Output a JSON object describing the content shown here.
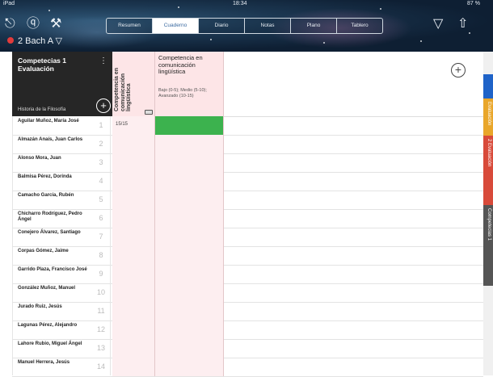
{
  "status_bar": {
    "device": "iPad",
    "time": "18:34",
    "battery": "87 %"
  },
  "nav": {
    "class_label": "2 Bach A"
  },
  "tabs": [
    {
      "label": "Resumen",
      "active": false
    },
    {
      "label": "Cuaderno",
      "active": true
    },
    {
      "label": "Diario",
      "active": false
    },
    {
      "label": "Notas",
      "active": false
    },
    {
      "label": "Plano",
      "active": false
    },
    {
      "label": "Tablero",
      "active": false
    }
  ],
  "header": {
    "title": "Competecias 1 Evaluación",
    "subject": "Historia de la Filosofía",
    "col1_title": "Competencia en comunicación lingüística",
    "col2_title": "Competencia en comunicación lingüística",
    "col2_desc": "Bajo (0-5); Medio (5-10); Avanzado (10-15)"
  },
  "students": [
    {
      "name": "Aguilar Muñoz, María José",
      "num": "1",
      "score": "15/15",
      "green": true
    },
    {
      "name": "Almazán Anaís, Juan Carlos",
      "num": "2",
      "score": "",
      "green": false
    },
    {
      "name": "Alonso Mora, Juan",
      "num": "3",
      "score": "",
      "green": false
    },
    {
      "name": "Balmisa Pérez, Dorinda",
      "num": "4",
      "score": "",
      "green": false
    },
    {
      "name": "Camacho García, Rubén",
      "num": "5",
      "score": "",
      "green": false
    },
    {
      "name": "Chicharro Rodríguez, Pedro Ángel",
      "num": "6",
      "score": "",
      "green": false
    },
    {
      "name": "Conejero Álvarez, Santiago",
      "num": "7",
      "score": "",
      "green": false
    },
    {
      "name": "Corpas Gómez, Jaime",
      "num": "8",
      "score": "",
      "green": false
    },
    {
      "name": "Garrido Plaza, Francisco José",
      "num": "9",
      "score": "",
      "green": false
    },
    {
      "name": "González Muñoz, Manuel",
      "num": "10",
      "score": "",
      "green": false
    },
    {
      "name": "Jurado Ruiz, Jesús",
      "num": "11",
      "score": "",
      "green": false
    },
    {
      "name": "Lagunas Pérez, Alejandro",
      "num": "12",
      "score": "",
      "green": false
    },
    {
      "name": "Lahore Rubio, Miguel Ángel",
      "num": "13",
      "score": "",
      "green": false
    },
    {
      "name": "Manuel Herrera, Jesús",
      "num": "14",
      "score": "",
      "green": false
    }
  ],
  "side_tabs": [
    {
      "label": "Evaluación",
      "color": "#e9a62a"
    },
    {
      "label": "2 Evaluación",
      "color": "#d84a3a"
    },
    {
      "label": "Competecias 1",
      "color": "#555555"
    }
  ],
  "colors": {
    "accent_green": "#3cb24e",
    "pink_cell": "#fdeef0",
    "blue_tab": "#1f63c8"
  }
}
